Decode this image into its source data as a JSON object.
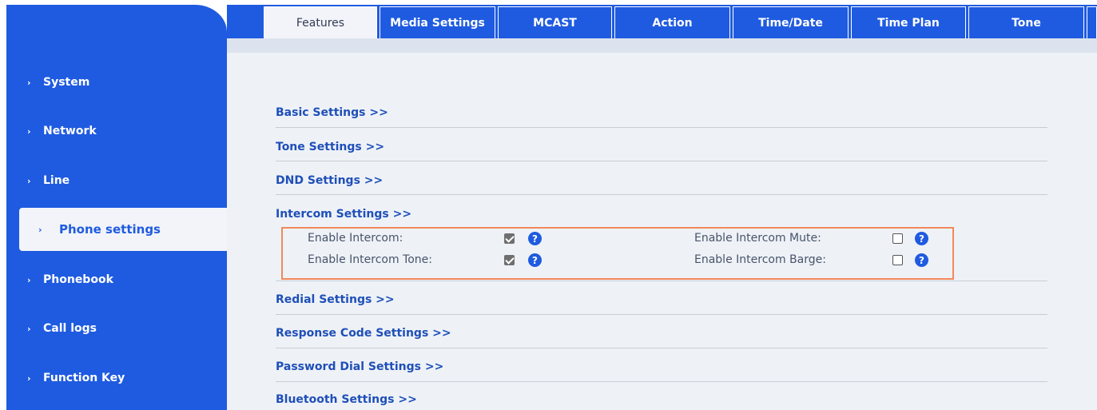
{
  "sidebar": {
    "items": [
      {
        "label": "System"
      },
      {
        "label": "Network"
      },
      {
        "label": "Line"
      },
      {
        "label": "Phone settings"
      },
      {
        "label": "Phonebook"
      },
      {
        "label": "Call logs"
      },
      {
        "label": "Function Key"
      }
    ],
    "active": "Phone settings"
  },
  "tabs": [
    {
      "label": "Features"
    },
    {
      "label": "Media Settings"
    },
    {
      "label": "MCAST"
    },
    {
      "label": "Action"
    },
    {
      "label": "Time/Date"
    },
    {
      "label": "Time Plan"
    },
    {
      "label": "Tone"
    }
  ],
  "sections": {
    "basic": "Basic Settings >>",
    "tone": "Tone Settings >>",
    "dnd": "DND Settings >>",
    "intercom": "Intercom Settings >>",
    "redial": "Redial Settings >>",
    "response_code": "Response Code Settings >>",
    "password_dial": "Password Dial Settings >>",
    "bluetooth": "Bluetooth Settings >>"
  },
  "intercom": {
    "enable_intercom": {
      "label": "Enable Intercom:",
      "checked": true
    },
    "enable_intercom_tone": {
      "label": "Enable Intercom Tone:",
      "checked": true
    },
    "enable_intercom_mute": {
      "label": "Enable Intercom Mute:",
      "checked": false
    },
    "enable_intercom_barge": {
      "label": "Enable Intercom Barge:",
      "checked": false
    }
  },
  "icons": {
    "sidebar_bullet": "›",
    "help": "?"
  },
  "colors": {
    "primary": "#1f5be0",
    "highlight_border": "#f2885a",
    "content_bg": "#eef2f7",
    "link": "#1f4fb8"
  }
}
